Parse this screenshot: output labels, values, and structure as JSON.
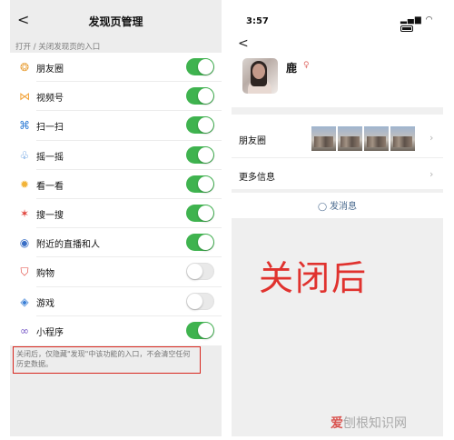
{
  "left": {
    "nav_back": "<",
    "title": "发现页管理",
    "section_label": "打开 / 关闭发现页的入口",
    "items": [
      {
        "label": "朋友圈",
        "icon": "moments-icon",
        "glyph": "❂",
        "color": "#e9a13b",
        "on": true
      },
      {
        "label": "视频号",
        "icon": "channels-icon",
        "glyph": "⋈",
        "color": "#f2a33a",
        "on": true
      },
      {
        "label": "扫一扫",
        "icon": "scan-icon",
        "glyph": "⌘",
        "color": "#2e7cd6",
        "on": true
      },
      {
        "label": "摇一摇",
        "icon": "shake-icon",
        "glyph": "♧",
        "color": "#2e7cd6",
        "on": true
      },
      {
        "label": "看一看",
        "icon": "top-stories-icon",
        "glyph": "✹",
        "color": "#f2b338",
        "on": true
      },
      {
        "label": "搜一搜",
        "icon": "search-icon",
        "glyph": "✶",
        "color": "#e0423a",
        "on": true
      },
      {
        "label": "附近的直播和人",
        "icon": "nearby-icon",
        "glyph": "◉",
        "color": "#3a6fc6",
        "on": true
      },
      {
        "label": "购物",
        "icon": "shopping-icon",
        "glyph": "⛉",
        "color": "#e0423a",
        "on": false
      },
      {
        "label": "游戏",
        "icon": "games-icon",
        "glyph": "◈",
        "color": "#3a7fd6",
        "on": false
      },
      {
        "label": "小程序",
        "icon": "mini-programs-icon",
        "glyph": "∞",
        "color": "#7a5cc8",
        "on": true
      }
    ],
    "note": "关闭后，仅隐藏\"发现\"中该功能的入口，不会清空任何历史数据。"
  },
  "right": {
    "status_time": "3:57",
    "back": "<",
    "profile_name": "鹿",
    "moments_label": "朋友圈",
    "more_info_label": "更多信息",
    "send_message": "发消息",
    "closed_label": "关闭后"
  },
  "watermark": {
    "logo": "爱",
    "text": "刨根知识网"
  },
  "colors": {
    "toggle_on": "#3fb34f",
    "toggle_off": "#e9e9e9",
    "note_border": "#d7261e",
    "closed_label": "#e0322e",
    "link_blue": "#4b6b8f"
  }
}
